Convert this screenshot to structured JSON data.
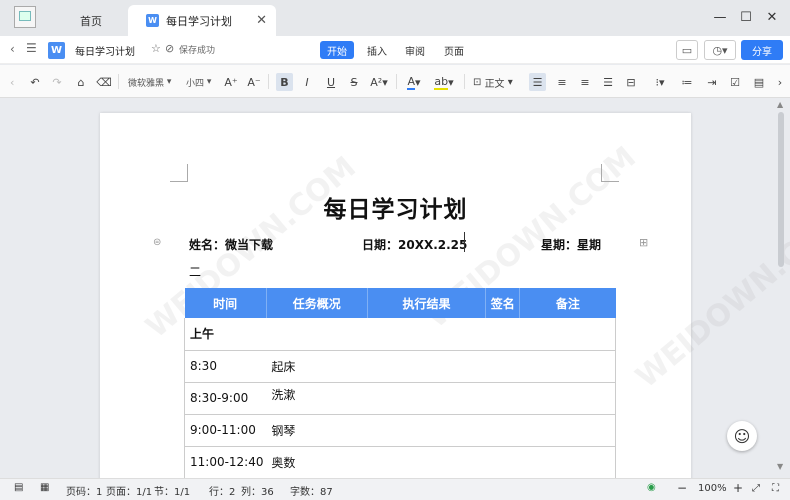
{
  "tabs": {
    "home": "首页",
    "document": "每日学习计划"
  },
  "doc_icon_letter": "W",
  "titlebar": {
    "filename": "每日学习计划",
    "save_status": "保存成功",
    "menu": [
      "开始",
      "插入",
      "审阅",
      "页面"
    ],
    "share": "分享"
  },
  "toolbar": {
    "font_name": "微软雅黑",
    "font_size": "小四",
    "style": "正文"
  },
  "document": {
    "title": "每日学习计划",
    "name_label": "姓名：微当下载",
    "date_label": "日期：20XX.2.25",
    "weekday_label": "星期：星期",
    "weekday_wrap": "二",
    "table_headers": [
      "时间",
      "任务概况",
      "执行结果",
      "签名",
      "备注"
    ],
    "section": "上午",
    "rows": [
      [
        "8:30",
        "起床"
      ],
      [
        "8:30-9:00",
        "洗漱"
      ],
      [
        "9:00-11:00",
        "钢琴"
      ],
      [
        "11:00-12:40",
        "奥数"
      ]
    ],
    "watermark": "WEIDOWN.COM"
  },
  "statusbar": {
    "page_num": "页码：1",
    "page": "页面：1/1",
    "section": "节：1/1",
    "row": "行：2",
    "col": "列：36",
    "words": "字数：87",
    "zoom": "100%"
  },
  "colors": {
    "accent": "#2f7cf6",
    "table_header": "#4a8ef2"
  }
}
